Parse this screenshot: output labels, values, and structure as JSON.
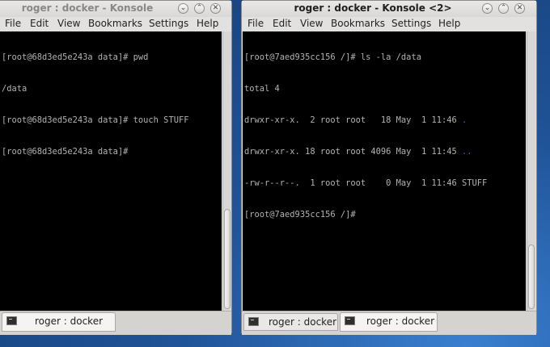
{
  "windows": [
    {
      "title": "roger : docker - Konsole",
      "menu": [
        "File",
        "Edit",
        "View",
        "Bookmarks",
        "Settings",
        "Help"
      ],
      "lines": [
        "[root@68d3ed5e243a data]# pwd",
        "/data",
        "[root@68d3ed5e243a data]# touch STUFF",
        "[root@68d3ed5e243a data]# "
      ],
      "tabs": [
        {
          "label": "roger : docker",
          "icon": "terminal-icon"
        }
      ]
    },
    {
      "title": "roger : docker - Konsole <2>",
      "menu": [
        "File",
        "Edit",
        "View",
        "Bookmarks",
        "Settings",
        "Help"
      ],
      "lines": [
        "[root@7aed935cc156 /]# ls -la /data",
        "total 4",
        "drwxr-xr-x.  2 root root   18 May  1 11:46 ",
        "drwxr-xr-x. 18 root root 4096 May  1 11:45 ",
        "-rw-r--r--.  1 root root    0 May  1 11:46 STUFF",
        "[root@7aed935cc156 /]# "
      ],
      "dir_entries": [
        ".",
        ".."
      ],
      "tabs": [
        {
          "label": "roger : docker",
          "icon": "terminal-icon"
        },
        {
          "label": "roger : docker",
          "icon": "terminal-icon"
        }
      ]
    }
  ],
  "window_buttons": {
    "minimize": "⌄",
    "maximize": "⌃",
    "close": "✕"
  },
  "colors": {
    "terminal_bg": "#000000",
    "terminal_fg": "#b2b2b2",
    "directory": "#5454ff",
    "window_chrome": "#e3e1df"
  }
}
